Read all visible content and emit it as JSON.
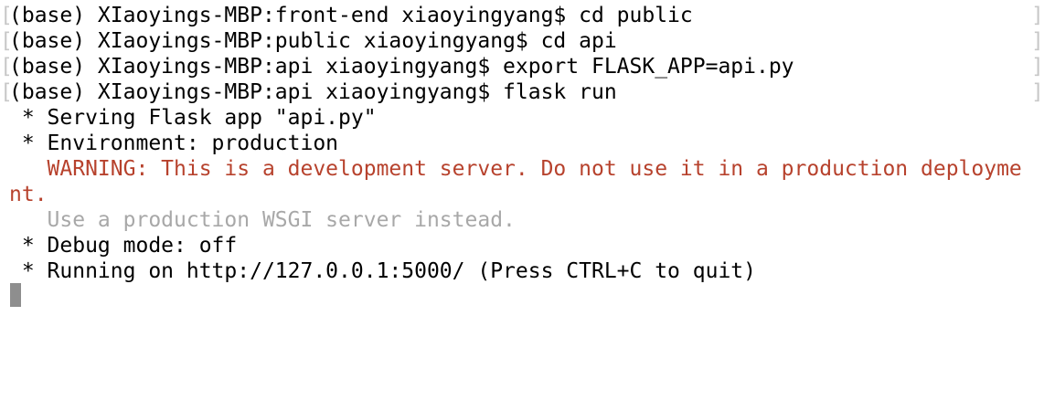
{
  "terminal": {
    "prompt_lines": [
      "(base) XIaoyings-MBP:front-end xiaoyingyang$ cd public",
      "(base) XIaoyings-MBP:public xiaoyingyang$ cd api",
      "(base) XIaoyings-MBP:api xiaoyingyang$ export FLASK_APP=api.py",
      "(base) XIaoyings-MBP:api xiaoyingyang$ flask run"
    ],
    "bracket_left": "[",
    "bracket_right": "]",
    "output": {
      "serving": " * Serving Flask app \"api.py\"",
      "environment": " * Environment: production",
      "warning_1": "   WARNING: This is a development server. Do not use it in a production deployme",
      "warning_2": "nt.",
      "use_production": "   Use a production WSGI server instead.",
      "debug_mode": " * Debug mode: off",
      "running_on": " * Running on http://127.0.0.1:5000/ (Press CTRL+C to quit)"
    },
    "colors": {
      "text": "#000000",
      "warning": "#b7422d",
      "dim": "#a8a8a8",
      "cursor": "#8e8e8e",
      "background": "#ffffff"
    }
  }
}
